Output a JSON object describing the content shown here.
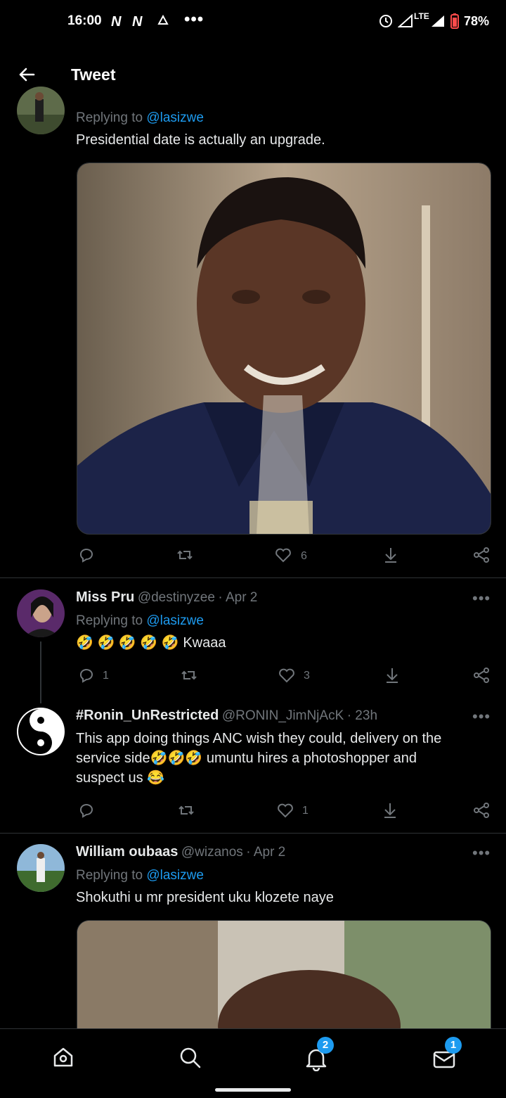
{
  "status_bar": {
    "time": "16:00",
    "notif_icons": [
      "N",
      "N"
    ],
    "more": "•••",
    "network": "LTE",
    "battery": "78%"
  },
  "header": {
    "title": "Tweet"
  },
  "tweets": [
    {
      "replying_label": "Replying to",
      "replying_handle": "@lasizwe",
      "text": "Presidential date is actually an upgrade.",
      "replies": "",
      "retweets": "",
      "likes": "6"
    },
    {
      "name": "Miss Pru",
      "handle": "@destinyzee",
      "date": "· Apr 2",
      "replying_label": "Replying to",
      "replying_handle": "@lasizwe",
      "emoji": "🤣 🤣 🤣 🤣 🤣",
      "text": "Kwaaa",
      "replies": "1",
      "likes": "3"
    },
    {
      "name": "#Ronin_UnRestricted",
      "handle": "@RONIN_JimNjAcK",
      "date": "· 23h",
      "line1": "This app doing things ANC wish they could, delivery on the",
      "line2_a": "service side",
      "line2_emoji": "🤣🤣🤣",
      "line2_b": " umuntu hires a photoshopper and",
      "line3_a": "suspect us ",
      "line3_emoji": "😂",
      "replies": "",
      "likes": "1"
    },
    {
      "name": "William oubaas",
      "handle": "@wizanos",
      "date": "· Apr 2",
      "replying_label": "Replying to",
      "replying_handle": "@lasizwe",
      "text": "Shokuthi u mr president uku klozete naye"
    }
  ],
  "bottom_nav": {
    "notifications_badge": "2",
    "messages_badge": "1"
  },
  "colors": {
    "background": "#000000",
    "accent": "#1d9bf0",
    "muted": "#71767b"
  }
}
